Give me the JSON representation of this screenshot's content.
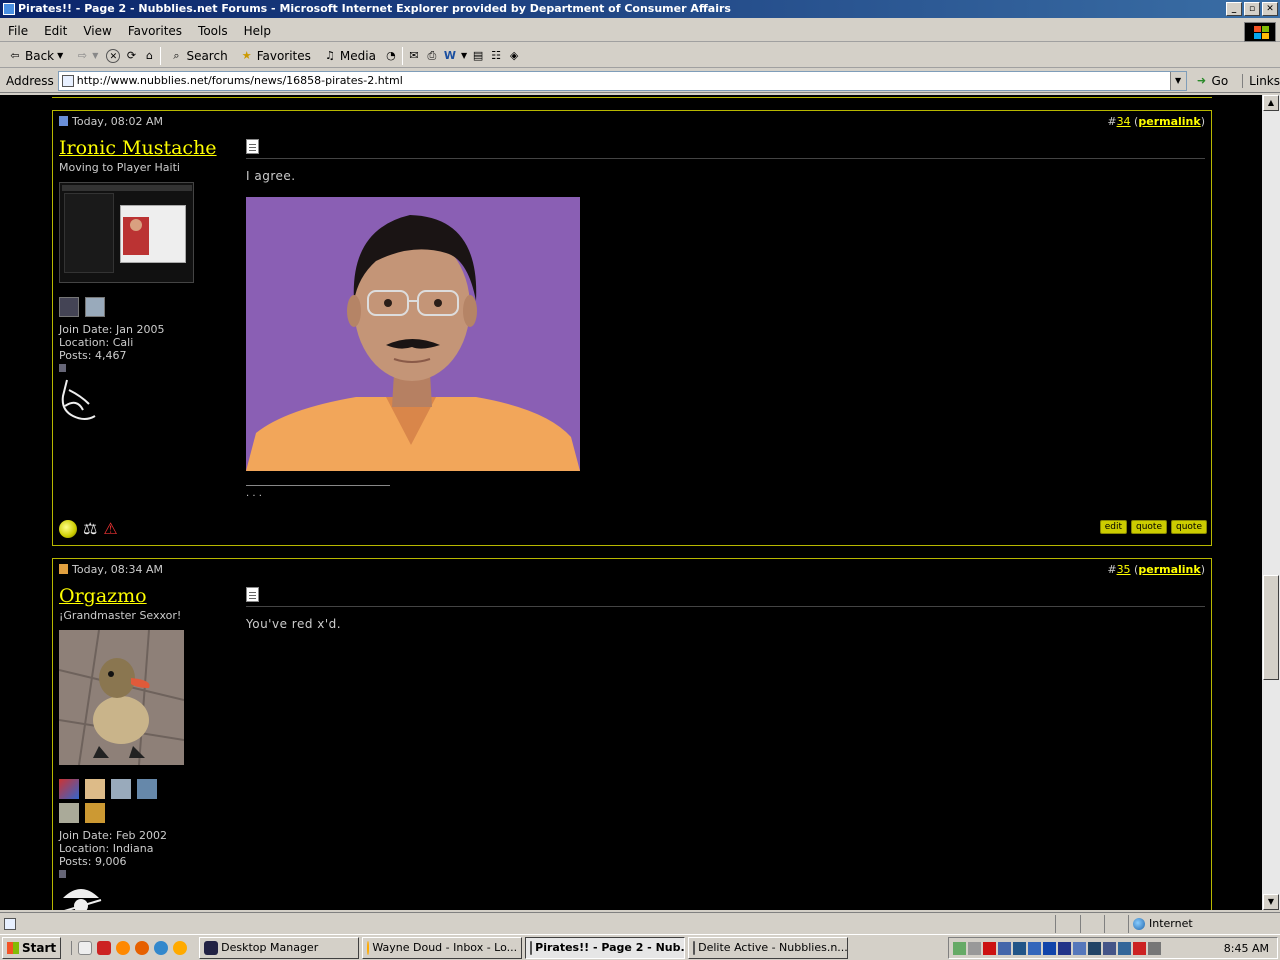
{
  "window": {
    "title": "Pirates!! - Page 2 - Nubblies.net Forums - Microsoft Internet Explorer provided by Department of Consumer Affairs",
    "min": "_",
    "max": "▫",
    "close": "✕"
  },
  "menu": [
    "File",
    "Edit",
    "View",
    "Favorites",
    "Tools",
    "Help"
  ],
  "toolbar": {
    "back": "Back",
    "search": "Search",
    "favorites": "Favorites",
    "media": "Media"
  },
  "address": {
    "label": "Address",
    "url": "http://www.nubblies.net/forums/news/16858-pirates-2.html",
    "go": "Go",
    "links": "Links"
  },
  "posts": [
    {
      "time": "Today, 08:02 AM",
      "number_prefix": "#",
      "number": "34",
      "permalink": "permalink",
      "username": "Ironic Mustache",
      "usertitle": "Moving to Player Haiti",
      "join": "Join Date: Jan 2005",
      "location": "Location: Cali",
      "posts": "Posts: 4,467",
      "message": "I agree.",
      "signature": ". . .",
      "buttons": [
        "edit",
        "quote",
        "quote"
      ]
    },
    {
      "time": "Today, 08:34 AM",
      "number_prefix": "#",
      "number": "35",
      "permalink": "permalink",
      "username": "Orgazmo",
      "usertitle": "¡Grandmaster Sexxor!",
      "join": "Join Date: Feb 2002",
      "location": "Location: Indiana",
      "posts": "Posts: 9,006",
      "message": "You've red x'd."
    }
  ],
  "status": {
    "zone": "Internet"
  },
  "taskbar": {
    "start": "Start",
    "tasks": [
      "Desktop Manager",
      "Wayne Doud - Inbox - Lo...",
      "Pirates!! - Page 2 - Nub...",
      "Delite Active - Nubblies.n..."
    ],
    "clock": "8:45 AM"
  },
  "colors": {
    "accent_yellow": "#ffff00",
    "post_border": "#b8b800",
    "title_blue": "#0a246a"
  }
}
